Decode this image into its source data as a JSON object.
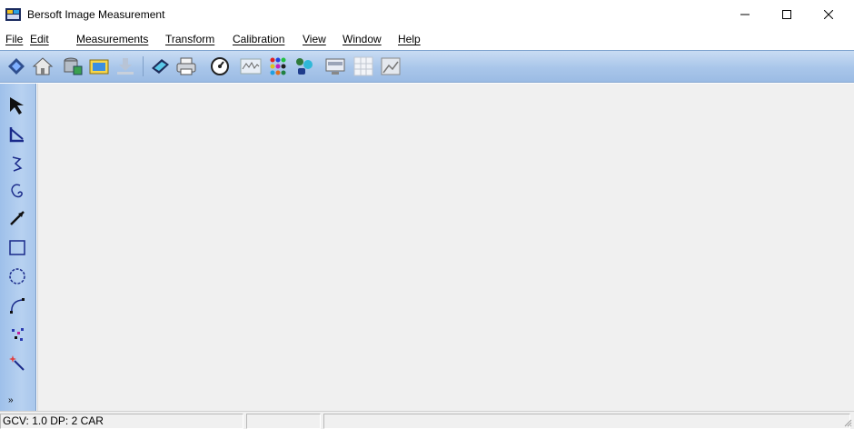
{
  "window": {
    "title": "Bersoft Image Measurement",
    "icon": "app-icon"
  },
  "menu": [
    {
      "label": "File"
    },
    {
      "label": "Edit"
    },
    {
      "label": "Measurements"
    },
    {
      "label": "Transform"
    },
    {
      "label": "Calibration"
    },
    {
      "label": "View"
    },
    {
      "label": "Window"
    },
    {
      "label": "Help"
    }
  ],
  "toolbar": [
    {
      "icon": "sync-diamond-icon"
    },
    {
      "icon": "home-icon"
    },
    {
      "icon": "database-icon"
    },
    {
      "icon": "open-image-icon"
    },
    {
      "icon": "download-icon"
    },
    {
      "icon": "scanner-icon"
    },
    {
      "icon": "printer-icon"
    },
    {
      "icon": "gauge-icon"
    },
    {
      "icon": "line-profile-icon"
    },
    {
      "icon": "color-dots-icon"
    },
    {
      "icon": "particles-icon"
    },
    {
      "icon": "ruler-monitor-icon"
    },
    {
      "icon": "grid-icon"
    },
    {
      "icon": "image-frame-icon"
    }
  ],
  "palette": [
    {
      "icon": "select-arrow-icon"
    },
    {
      "icon": "angle-tool-icon"
    },
    {
      "icon": "polyline-tool-icon"
    },
    {
      "icon": "freehand-tool-icon"
    },
    {
      "icon": "line-tool-icon"
    },
    {
      "icon": "rectangle-tool-icon"
    },
    {
      "icon": "ellipse-tool-icon"
    },
    {
      "icon": "arc-tool-icon"
    },
    {
      "icon": "points-tool-icon"
    },
    {
      "icon": "magic-wand-icon"
    }
  ],
  "palette_more": "»",
  "statusbar": {
    "panel1": "GCV: 1.0 DP: 2  CAR",
    "panel2": "",
    "panel3": ""
  },
  "colors": {
    "toolbar_bg": "#a9c6ea",
    "workspace_bg": "#f0f0f0"
  }
}
